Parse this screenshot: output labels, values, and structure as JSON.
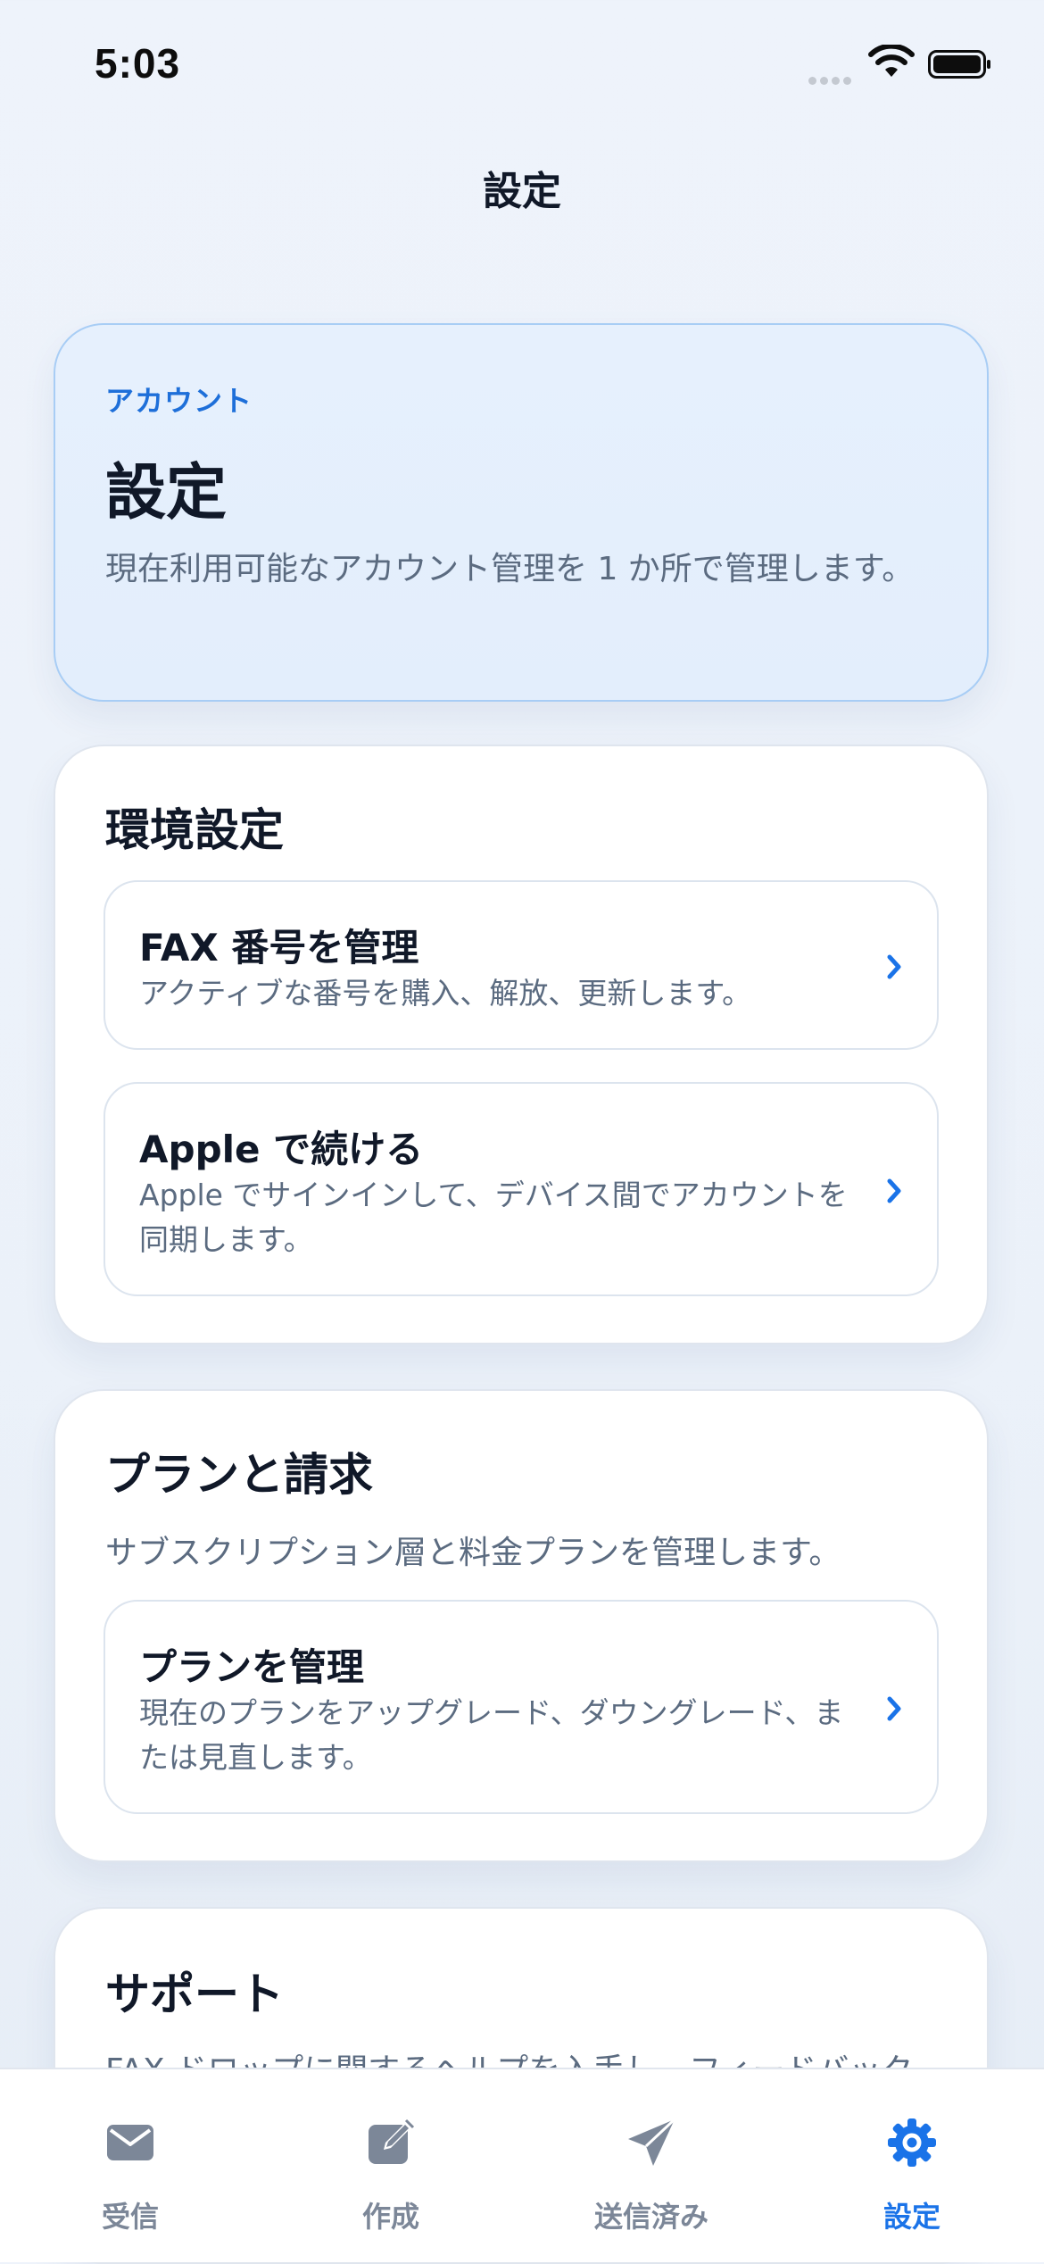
{
  "status_bar": {
    "time": "5:03"
  },
  "nav": {
    "title": "設定"
  },
  "hero": {
    "eyebrow": "アカウント",
    "title": "設定",
    "description": "現在利用可能なアカウント管理を 1 か所で管理します。"
  },
  "sections": {
    "environment": {
      "title": "環境設定",
      "rows": [
        {
          "title": "FAX 番号を管理",
          "description": "アクティブな番号を購入、解放、更新します。"
        },
        {
          "title": "Apple で続ける",
          "description": "Apple でサインインして、デバイス間でアカウントを同期します。"
        }
      ]
    },
    "plan": {
      "title": "プランと請求",
      "description": "サブスクリプション層と料金プランを管理します。",
      "rows": [
        {
          "title": "プランを管理",
          "description": "現在のプランをアップグレード、ダウングレード、または見直します。"
        }
      ]
    },
    "support": {
      "title": "サポート",
      "description": "FAX ドロップに関するヘルプを入手し、フィードバックを送信します。"
    }
  },
  "tabs": [
    {
      "label": "受信",
      "icon": "inbox-icon",
      "active": false
    },
    {
      "label": "作成",
      "icon": "compose-icon",
      "active": false
    },
    {
      "label": "送信済み",
      "icon": "send-icon",
      "active": false
    },
    {
      "label": "設定",
      "icon": "gear-icon",
      "active": true
    }
  ],
  "colors": {
    "accent": "#1a73e8",
    "tab_inactive": "#7c8798",
    "hero_background": "#e4effc",
    "hero_border": "#a8cdf5"
  }
}
